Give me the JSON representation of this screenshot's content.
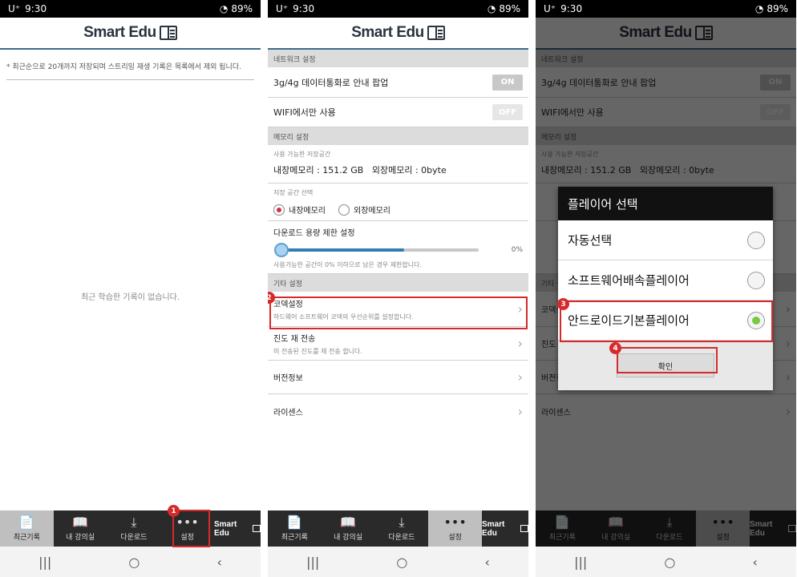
{
  "status": {
    "carrier": "U⁺",
    "time": "9:30",
    "signal_battery": "89%"
  },
  "app": {
    "logo_text": "Smart Edu"
  },
  "recent": {
    "notice": "* 최근순으로 20개까지 저장되며 스트리밍 재생 기록은 목록에서 제외 됩니다.",
    "empty_message": "최근 학습한 기록이 없습니다."
  },
  "nav": {
    "items": [
      {
        "label": "최근기록",
        "icon": "recent-icon"
      },
      {
        "label": "내 강의실",
        "icon": "book-icon"
      },
      {
        "label": "다운로드",
        "icon": "download-icon"
      },
      {
        "label": "설정",
        "icon": "more-icon"
      }
    ],
    "logo_text": "Smart Edu"
  },
  "settings": {
    "network_header": "네트워크 설정",
    "data_popup_label": "3g/4g 데이터통화로 안내 팝업",
    "data_popup_state": "ON",
    "wifi_only_label": "WIFI에서만 사용",
    "wifi_only_state": "OFF",
    "memory_header": "메모리 설정",
    "available_storage_label": "사용 가능한 저장공간",
    "internal_memory_value": "내장메모리 : 151.2 GB",
    "external_memory_value": "외장메모리 : 0byte",
    "storage_select_label": "저장 공간 선택",
    "internal_option": "내장메모리",
    "external_option": "외장메모리",
    "download_limit_label": "다운로드 용량 제한 설정",
    "download_limit_percent": "0%",
    "download_limit_fill": 0.62,
    "download_limit_desc": "사용가능한 공간이 0% 이하으로 남은 경우 제한합니다.",
    "other_header": "기타 설정",
    "codec_title": "코덱설정",
    "codec_desc": "하드웨어 소프트웨어 코덱의 우선순위를 설정합니다.",
    "progress_title": "진도 재 전송",
    "progress_desc": "미 전송된 진도를 재 전송 합니다.",
    "version_title": "버전정보",
    "license_title": "라이센스"
  },
  "dialog": {
    "title": "플레이어 선택",
    "options": [
      "자동선택",
      "소프트웨어배속플레이어",
      "안드로이드기본플레이어"
    ],
    "selected_index": 2,
    "confirm_label": "확인"
  },
  "steps": {
    "one": "1",
    "two": "2",
    "three": "3",
    "four": "4"
  }
}
